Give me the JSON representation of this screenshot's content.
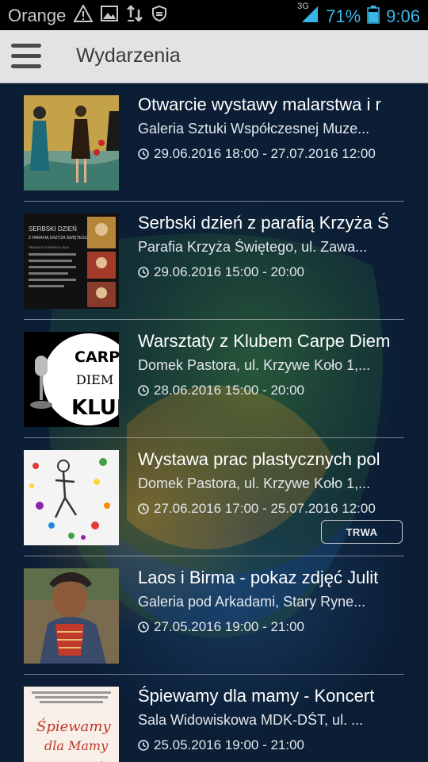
{
  "status_bar": {
    "carrier": "Orange",
    "network": "3G",
    "battery": "71%",
    "time": "9:06"
  },
  "app_bar": {
    "title": "Wydarzenia"
  },
  "events": [
    {
      "title": "Otwarcie wystawy malarstwa i r",
      "place": "Galeria Sztuki Współczesnej Muze...",
      "date": "29.06.2016 18:00 - 27.07.2016 12:00",
      "badge": ""
    },
    {
      "title": "Serbski dzień z parafią Krzyża Ś",
      "place": "Parafia Krzyża Świętego, ul. Zawa...",
      "date": "29.06.2016 15:00 - 20:00",
      "badge": "",
      "thumb_text": [
        "SERBSKI DZIEŃ",
        "Z PARAFIĄ KRZYŻA ŚWIĘTEGO",
        "ŚRODA 29 CZERWCA 2016"
      ]
    },
    {
      "title": "Warsztaty z Klubem Carpe Diem",
      "place": "Domek Pastora, ul. Krzywe Koło 1,...",
      "date": "28.06.2016 15:00 - 20:00",
      "badge": "",
      "thumb_text": [
        "CARPE",
        "DIEM",
        "KLUB"
      ]
    },
    {
      "title": "Wystawa prac plastycznych pol",
      "place": "Domek Pastora, ul. Krzywe Koło 1,...",
      "date": "27.06.2016 17:00 - 25.07.2016 12:00",
      "badge": "TRWA"
    },
    {
      "title": "Laos i Birma - pokaz zdjęć Julit",
      "place": "Galeria pod Arkadami, Stary Ryne...",
      "date": "27.05.2016 19:00 - 21:00",
      "badge": ""
    },
    {
      "title": "Śpiewamy dla mamy - Koncert",
      "place": "Sala Widowiskowa MDK-DŚT, ul. ...",
      "date": "25.05.2016 19:00 - 21:00",
      "badge": "",
      "thumb_text": [
        "Śpiewamy",
        "dla Mamy"
      ]
    }
  ]
}
